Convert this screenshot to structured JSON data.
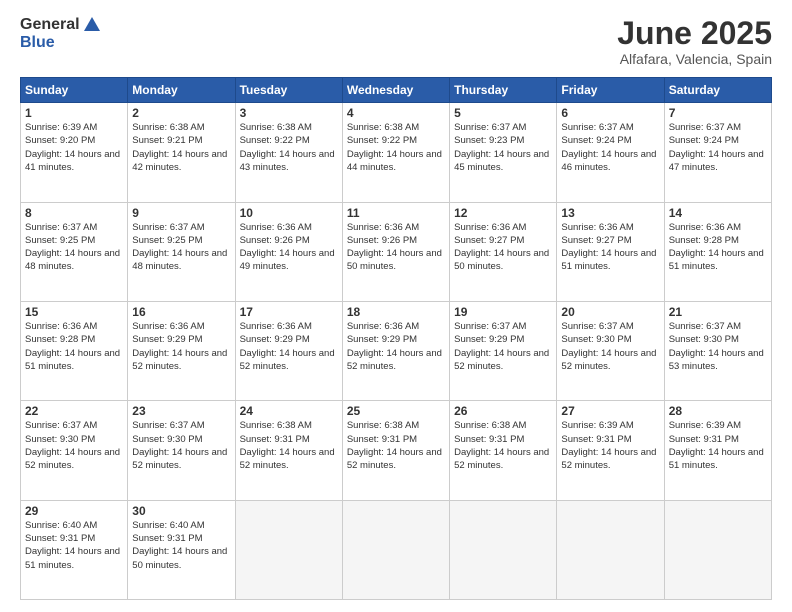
{
  "header": {
    "logo_general": "General",
    "logo_blue": "Blue",
    "title": "June 2025",
    "subtitle": "Alfafara, Valencia, Spain"
  },
  "calendar": {
    "days": [
      "Sunday",
      "Monday",
      "Tuesday",
      "Wednesday",
      "Thursday",
      "Friday",
      "Saturday"
    ],
    "weeks": [
      [
        null,
        {
          "day": 2,
          "sunrise": "6:38 AM",
          "sunset": "9:21 PM",
          "daylight": "14 hours and 42 minutes."
        },
        {
          "day": 3,
          "sunrise": "6:38 AM",
          "sunset": "9:22 PM",
          "daylight": "14 hours and 43 minutes."
        },
        {
          "day": 4,
          "sunrise": "6:38 AM",
          "sunset": "9:22 PM",
          "daylight": "14 hours and 44 minutes."
        },
        {
          "day": 5,
          "sunrise": "6:37 AM",
          "sunset": "9:23 PM",
          "daylight": "14 hours and 45 minutes."
        },
        {
          "day": 6,
          "sunrise": "6:37 AM",
          "sunset": "9:24 PM",
          "daylight": "14 hours and 46 minutes."
        },
        {
          "day": 7,
          "sunrise": "6:37 AM",
          "sunset": "9:24 PM",
          "daylight": "14 hours and 47 minutes."
        }
      ],
      [
        {
          "day": 1,
          "sunrise": "6:39 AM",
          "sunset": "9:20 PM",
          "daylight": "14 hours and 41 minutes."
        },
        null,
        null,
        null,
        null,
        null,
        null
      ],
      [
        {
          "day": 8,
          "sunrise": "6:37 AM",
          "sunset": "9:25 PM",
          "daylight": "14 hours and 48 minutes."
        },
        {
          "day": 9,
          "sunrise": "6:37 AM",
          "sunset": "9:25 PM",
          "daylight": "14 hours and 48 minutes."
        },
        {
          "day": 10,
          "sunrise": "6:36 AM",
          "sunset": "9:26 PM",
          "daylight": "14 hours and 49 minutes."
        },
        {
          "day": 11,
          "sunrise": "6:36 AM",
          "sunset": "9:26 PM",
          "daylight": "14 hours and 50 minutes."
        },
        {
          "day": 12,
          "sunrise": "6:36 AM",
          "sunset": "9:27 PM",
          "daylight": "14 hours and 50 minutes."
        },
        {
          "day": 13,
          "sunrise": "6:36 AM",
          "sunset": "9:27 PM",
          "daylight": "14 hours and 51 minutes."
        },
        {
          "day": 14,
          "sunrise": "6:36 AM",
          "sunset": "9:28 PM",
          "daylight": "14 hours and 51 minutes."
        }
      ],
      [
        {
          "day": 15,
          "sunrise": "6:36 AM",
          "sunset": "9:28 PM",
          "daylight": "14 hours and 51 minutes."
        },
        {
          "day": 16,
          "sunrise": "6:36 AM",
          "sunset": "9:29 PM",
          "daylight": "14 hours and 52 minutes."
        },
        {
          "day": 17,
          "sunrise": "6:36 AM",
          "sunset": "9:29 PM",
          "daylight": "14 hours and 52 minutes."
        },
        {
          "day": 18,
          "sunrise": "6:36 AM",
          "sunset": "9:29 PM",
          "daylight": "14 hours and 52 minutes."
        },
        {
          "day": 19,
          "sunrise": "6:37 AM",
          "sunset": "9:29 PM",
          "daylight": "14 hours and 52 minutes."
        },
        {
          "day": 20,
          "sunrise": "6:37 AM",
          "sunset": "9:30 PM",
          "daylight": "14 hours and 52 minutes."
        },
        {
          "day": 21,
          "sunrise": "6:37 AM",
          "sunset": "9:30 PM",
          "daylight": "14 hours and 53 minutes."
        }
      ],
      [
        {
          "day": 22,
          "sunrise": "6:37 AM",
          "sunset": "9:30 PM",
          "daylight": "14 hours and 52 minutes."
        },
        {
          "day": 23,
          "sunrise": "6:37 AM",
          "sunset": "9:30 PM",
          "daylight": "14 hours and 52 minutes."
        },
        {
          "day": 24,
          "sunrise": "6:38 AM",
          "sunset": "9:31 PM",
          "daylight": "14 hours and 52 minutes."
        },
        {
          "day": 25,
          "sunrise": "6:38 AM",
          "sunset": "9:31 PM",
          "daylight": "14 hours and 52 minutes."
        },
        {
          "day": 26,
          "sunrise": "6:38 AM",
          "sunset": "9:31 PM",
          "daylight": "14 hours and 52 minutes."
        },
        {
          "day": 27,
          "sunrise": "6:39 AM",
          "sunset": "9:31 PM",
          "daylight": "14 hours and 52 minutes."
        },
        {
          "day": 28,
          "sunrise": "6:39 AM",
          "sunset": "9:31 PM",
          "daylight": "14 hours and 51 minutes."
        }
      ],
      [
        {
          "day": 29,
          "sunrise": "6:40 AM",
          "sunset": "9:31 PM",
          "daylight": "14 hours and 51 minutes."
        },
        {
          "day": 30,
          "sunrise": "6:40 AM",
          "sunset": "9:31 PM",
          "daylight": "14 hours and 50 minutes."
        },
        null,
        null,
        null,
        null,
        null
      ]
    ]
  }
}
